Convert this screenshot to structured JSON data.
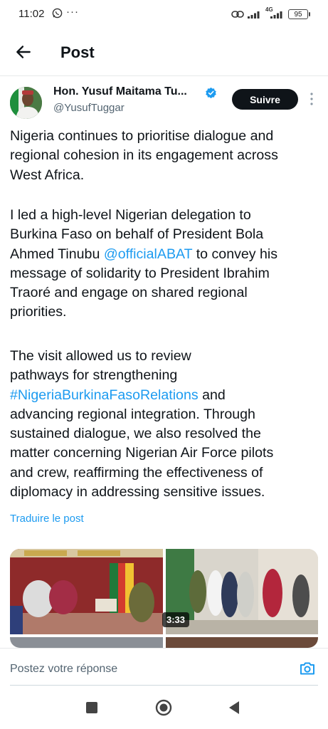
{
  "status_bar": {
    "time": "11:02",
    "more": "···",
    "network": "4G",
    "battery": "95"
  },
  "header": {
    "title": "Post"
  },
  "author": {
    "name": "Hon. Yusuf Maitama Tu...",
    "handle": "@YusufTuggar",
    "follow_label": "Suivre"
  },
  "post": {
    "paragraph1": [
      "Nigeria continues to prioritise dialogue and",
      "regional cohesion in its engagement across",
      "West Africa."
    ],
    "paragraph2": {
      "line1": "I led a high-level Nigerian delegation to",
      "line2": "Burkina Faso on behalf of President Bola",
      "line3_before": "Ahmed Tinubu ",
      "line3_mention": "@officialABAT",
      "line3_after": " to convey his",
      "line4": "message of solidarity to President Ibrahim",
      "line5": "Traoré and engage on shared regional",
      "line6": "priorities."
    },
    "paragraph3": {
      "line1": "The visit allowed us to review",
      "line2": "pathways for strengthening",
      "line3_hashtag": "#NigeriaBurkinaFasoRelations",
      "line3_after": " and",
      "line4": "advancing regional integration. Through",
      "line5": "sustained dialogue, we also resolved the",
      "line6": "matter concerning Nigerian Air Force pilots",
      "line7": "and crew, reaffirming the effectiveness of",
      "line8": "diplomacy in addressing sensitive issues."
    },
    "translate_label": "Traduire le post"
  },
  "media": {
    "video_duration": "3:33"
  },
  "reply": {
    "placeholder": "Postez votre réponse"
  },
  "colors": {
    "accent": "#1d9bf0",
    "text": "#0f1419",
    "secondary": "#536471",
    "follow_bg": "#0f1419"
  },
  "icons": [
    "back-arrow-icon",
    "verified-badge-icon",
    "more-options-icon",
    "camera-icon",
    "whatsapp-icon",
    "link-icon",
    "signal-icon",
    "battery-icon"
  ]
}
